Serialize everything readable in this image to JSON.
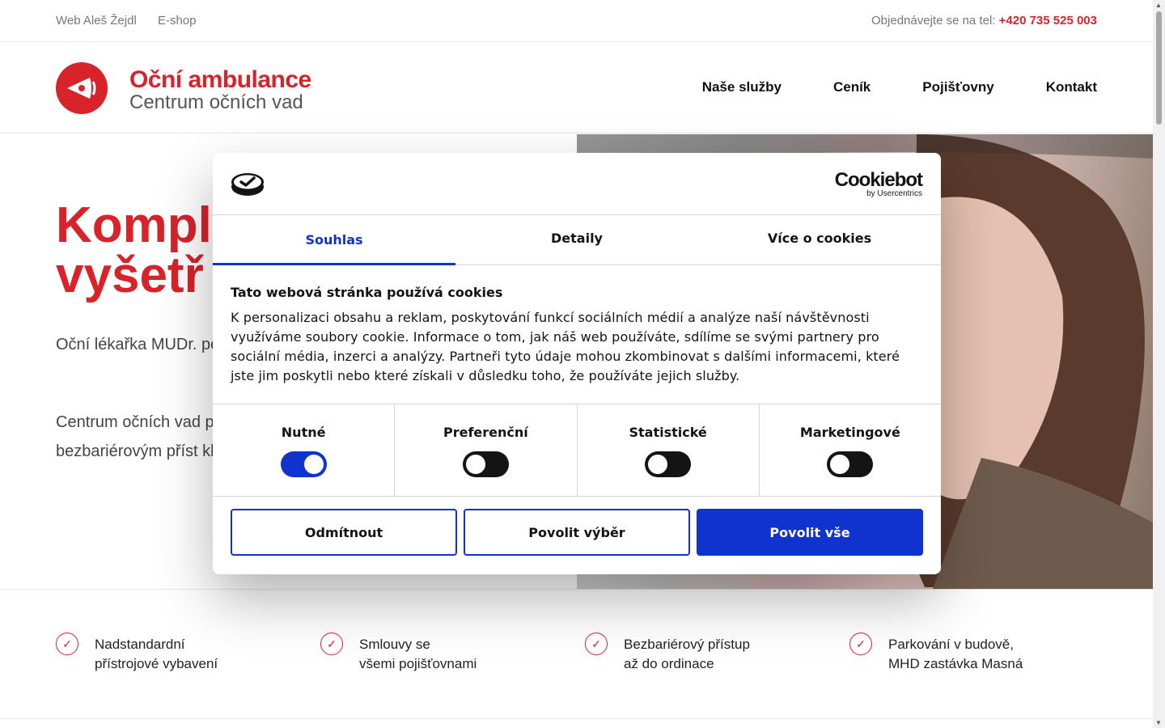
{
  "topbar": {
    "links": [
      "Web Aleš Žejdl",
      "E-shop"
    ],
    "phone_label": "Objednávejte se na tel:",
    "phone": "+420 735 525 003"
  },
  "header": {
    "brand_title": "Oční ambulance",
    "brand_subtitle": "Centrum očních vad",
    "nav": [
      "Naše služby",
      "Ceník",
      "Pojišťovny",
      "Kontakt"
    ]
  },
  "hero": {
    "title_line1": "Kompl",
    "title_line2": "vyšetř",
    "p1": "Oční lékařka MUDr. poskytuje preventiv",
    "p2": "Centrum očních vad polyfunkční budovy bezbariérovým příst klimatizovány a je z"
  },
  "features": [
    {
      "line1": "Nadstandardní",
      "line2": "přístrojové vybavení"
    },
    {
      "line1": "Smlouvy se",
      "line2": "všemi pojišťovnami"
    },
    {
      "line1": "Bezbariérový přístup",
      "line2": "až do ordinace"
    },
    {
      "line1": "Parkování v budově,",
      "line2": "MHD zastávka Masná"
    }
  ],
  "cookie": {
    "brand": "Cookiebot",
    "brand_sub": "by Usercentrics",
    "tabs": [
      "Souhlas",
      "Detaily",
      "Více o cookies"
    ],
    "heading": "Tato webová stránka používá cookies",
    "body": "K personalizaci obsahu a reklam, poskytování funkcí sociálních médií a analýze naší návštěvnosti využíváme soubory cookie. Informace o tom, jak náš web používáte, sdílíme se svými partnery pro sociální média, inzerci a analýzy. Partneři tyto údaje mohou zkombinovat s dalšími informacemi, které jste jim poskytli nebo které získali v důsledku toho, že používáte jejich služby.",
    "toggles": [
      {
        "label": "Nutné",
        "on": true
      },
      {
        "label": "Preferenční",
        "on": false
      },
      {
        "label": "Statistické",
        "on": false
      },
      {
        "label": "Marketingové",
        "on": false
      }
    ],
    "buttons": {
      "deny": "Odmítnout",
      "select": "Povolit výběr",
      "all": "Povolit vše"
    }
  },
  "colors": {
    "brand_red": "#d8232a",
    "cookie_blue": "#1032cf"
  }
}
